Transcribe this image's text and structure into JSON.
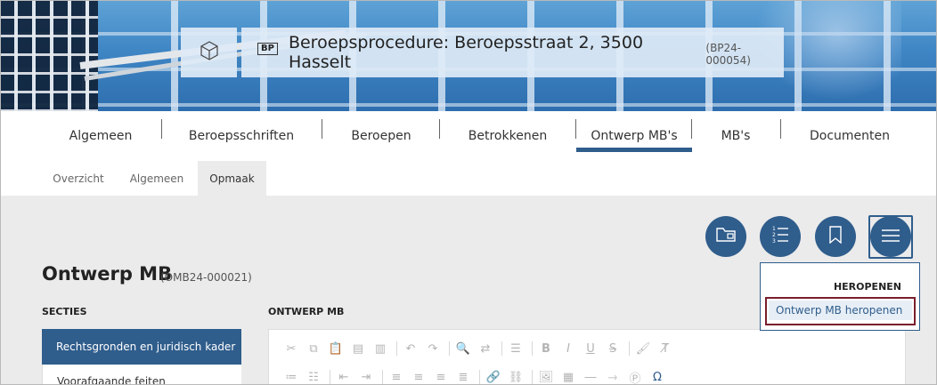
{
  "header": {
    "badge": "BP",
    "title": "Beroepsprocedure: Beroepsstraat 2, 3500 Hasselt",
    "code": "(BP24-000054)",
    "cube_icon": "cube-icon"
  },
  "main_tabs": [
    {
      "label": "Algemeen"
    },
    {
      "label": "Beroepsschriften"
    },
    {
      "label": "Beroepen"
    },
    {
      "label": "Betrokkenen"
    },
    {
      "label": "Ontwerp MB's",
      "active": true
    },
    {
      "label": "MB's"
    },
    {
      "label": "Documenten"
    }
  ],
  "sub_tabs": [
    {
      "label": "Overzicht"
    },
    {
      "label": "Algemeen"
    },
    {
      "label": "Opmaak",
      "active": true
    }
  ],
  "actions": [
    {
      "icon": "folder-icon"
    },
    {
      "icon": "numbered-list-icon"
    },
    {
      "icon": "bookmark-icon"
    },
    {
      "icon": "hamburger-menu-icon"
    }
  ],
  "page": {
    "title": "Ontwerp MB",
    "code": "(OMB24-000021)"
  },
  "sections": {
    "label": "SECTIES",
    "items": [
      "Rechtsgronden en juridisch kader",
      "Voorafgaande feiten"
    ]
  },
  "editor": {
    "label": "ONTWERP MB"
  },
  "dropdown": {
    "header": "HEROPENEN",
    "item": "Ontwerp MB heropenen"
  },
  "colors": {
    "primary": "#2f5d8c",
    "highlight_border": "#7a1f2b",
    "background": "#ebebeb"
  }
}
